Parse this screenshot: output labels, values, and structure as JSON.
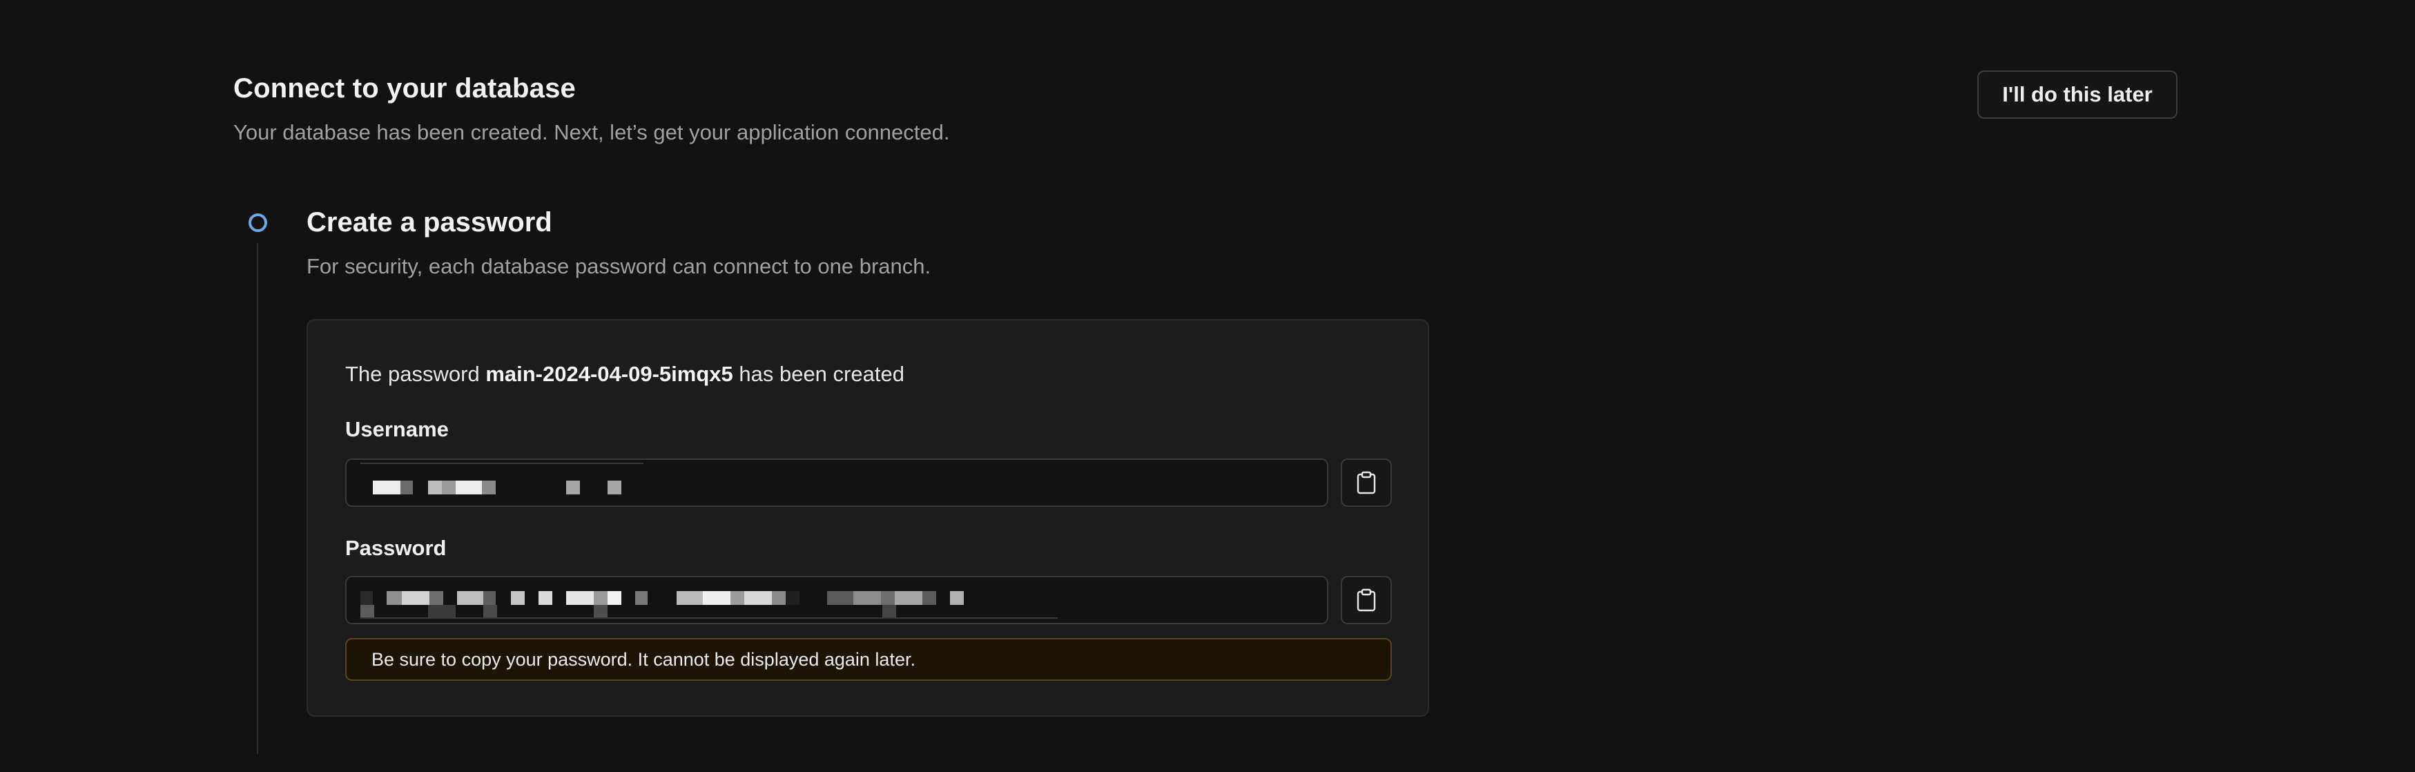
{
  "header": {
    "title": "Connect to your database",
    "subtitle": "Your database has been created. Next, let’s get your application connected.",
    "later_button": "I'll do this later"
  },
  "step": {
    "title": "Create a password",
    "subtitle": "For security, each database password can connect to one branch.",
    "indicator_color": "#6aa9e8"
  },
  "card": {
    "created_prefix": "The password ",
    "password_name": "main-2024-04-09-5imqx5",
    "created_suffix": " has been created",
    "username_label": "Username",
    "password_label": "Password",
    "copy_icon": "clipboard-icon",
    "warning": "Be sure to copy your password. It cannot be displayed again later."
  },
  "colors": {
    "background": "#121212",
    "card": "#1c1c1c",
    "warning_border": "#5b4516"
  }
}
